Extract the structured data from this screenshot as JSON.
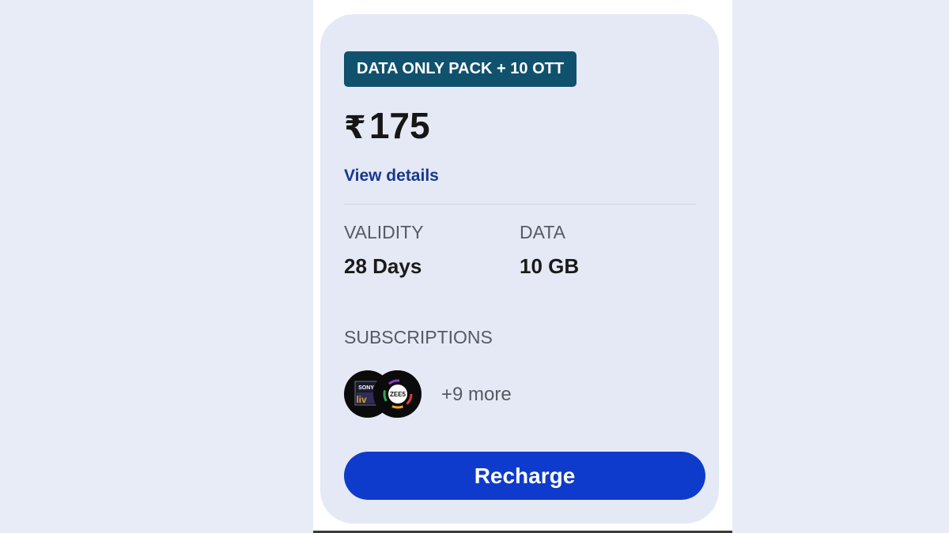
{
  "plan": {
    "badge": "DATA ONLY PACK + 10 OTT",
    "currency_symbol": "₹",
    "price": "175",
    "view_details_label": "View details",
    "validity_label": "VALIDITY",
    "validity_value": "28 Days",
    "data_label": "DATA",
    "data_value": "10 GB",
    "subscriptions_label": "SUBSCRIPTIONS",
    "subscription_logos": [
      {
        "icon": "sony-liv-logo-icon",
        "text_top": "SONY",
        "text_bottom": "liv"
      },
      {
        "icon": "zee5-logo-icon",
        "text": "ZEE5"
      }
    ],
    "more_subscriptions": "+9 more",
    "recharge_label": "Recharge"
  },
  "colors": {
    "page_background": "#e8ecf6",
    "card_background": "#e5e9f5",
    "badge_background": "#10516e",
    "link": "#16378f",
    "button": "#0e3bcc"
  }
}
